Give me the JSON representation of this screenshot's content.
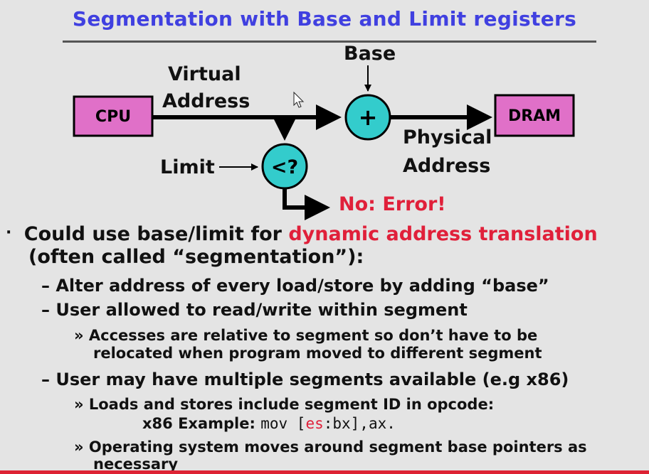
{
  "slide": {
    "title": "Segmentation with Base and Limit registers"
  },
  "diagram": {
    "cpu_label": "CPU",
    "dram_label": "DRAM",
    "virtual_address": [
      "Virtual",
      "Address"
    ],
    "physical_address": [
      "Physical",
      "Address"
    ],
    "base_label": "Base",
    "limit_label": "Limit",
    "adder_symbol": "+",
    "compare_symbol": "<?",
    "error_label": "No: Error!"
  },
  "bullets": {
    "main_prefix": "Could use base/limit for ",
    "main_highlight": "dynamic address translation",
    "main_line2": "(often called “segmentation”):",
    "sub1": "– Alter address of every load/store by adding “base”",
    "sub2": "– User allowed to read/write within segment",
    "sub2_detail_line1": "» Accesses are relative to segment so don’t have to be",
    "sub2_detail_line2": "relocated when program moved to different segment",
    "sub3": "– User may have multiple segments available (e.g x86)",
    "sub3_detail1_line1": "» Loads and stores include segment ID in opcode:",
    "sub3_detail1_example_label": "x86 Example: ",
    "sub3_detail1_code_a": "mov [",
    "sub3_detail1_code_es": "es",
    "sub3_detail1_code_b": ":bx],ax.",
    "sub3_detail2_line1": "» Operating system moves around segment base pointers as",
    "sub3_detail2_line2": "necessary"
  },
  "colors": {
    "title": "#4040e0",
    "box_fill": "#e070c8",
    "circle_fill": "#33cccc",
    "highlight": "#e0203a"
  }
}
